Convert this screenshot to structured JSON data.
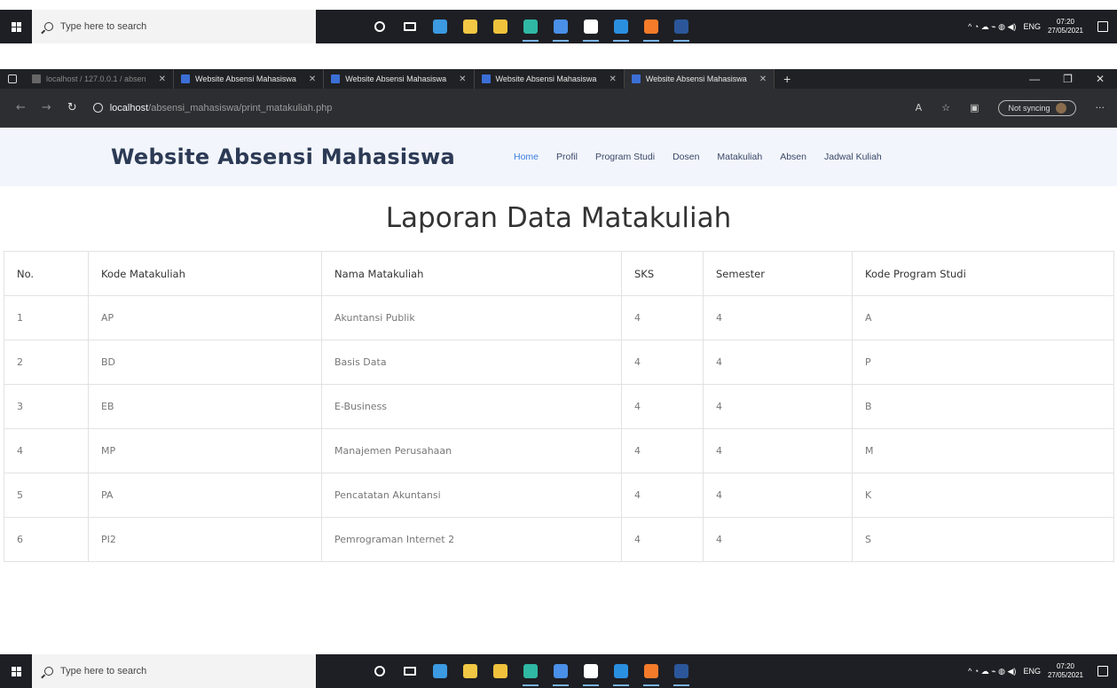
{
  "taskbar": {
    "search_placeholder": "Type here to search",
    "apps": [
      {
        "name": "cortana-icon",
        "color": "#ffffff"
      },
      {
        "name": "task-view-icon",
        "color": "#ffffff"
      },
      {
        "name": "edge-legacy-icon",
        "color": "#3b9ae1"
      },
      {
        "name": "file-explorer-icon",
        "color": "#f2c744"
      },
      {
        "name": "store-icon",
        "color": "#f0c23c"
      },
      {
        "name": "edge-icon",
        "color": "#2fb8a3"
      },
      {
        "name": "chrome-icon",
        "color": "#4a8fe8"
      },
      {
        "name": "settings-icon",
        "color": "#ffffff"
      },
      {
        "name": "vscode-icon",
        "color": "#2b8fe0"
      },
      {
        "name": "xampp-icon",
        "color": "#f47b2a"
      },
      {
        "name": "word-icon",
        "color": "#2b579a"
      }
    ],
    "tray": {
      "lang": "ENG",
      "time": "07:20",
      "date": "27/05/2021"
    }
  },
  "browser": {
    "tabs": [
      {
        "title": "localhost / 127.0.0.1 / absen",
        "active": false,
        "dim": true
      },
      {
        "title": "Website Absensi Mahasiswa",
        "active": false,
        "dim": false
      },
      {
        "title": "Website Absensi Mahasiswa",
        "active": false,
        "dim": false
      },
      {
        "title": "Website Absensi Mahasiswa",
        "active": false,
        "dim": false
      },
      {
        "title": "Website Absensi Mahasiswa",
        "active": true,
        "dim": false
      }
    ],
    "url_host": "localhost",
    "url_path": "/absensi_mahasiswa/print_matakuliah.php",
    "sync_label": "Not syncing"
  },
  "site": {
    "title": "Website Absensi Mahasiswa",
    "nav": [
      "Home",
      "Profil",
      "Program Studi",
      "Dosen",
      "Matakuliah",
      "Absen",
      "Jadwal Kuliah"
    ],
    "active_nav": "Home"
  },
  "report": {
    "title": "Laporan Data Matakuliah",
    "columns": [
      "No.",
      "Kode Matakuliah",
      "Nama Matakuliah",
      "SKS",
      "Semester",
      "Kode Program Studi"
    ],
    "rows": [
      [
        "1",
        "AP",
        "Akuntansi Publik",
        "4",
        "4",
        "A"
      ],
      [
        "2",
        "BD",
        "Basis Data",
        "4",
        "4",
        "P"
      ],
      [
        "3",
        "EB",
        "E-Business",
        "4",
        "4",
        "B"
      ],
      [
        "4",
        "MP",
        "Manajemen Perusahaan",
        "4",
        "4",
        "M"
      ],
      [
        "5",
        "PA",
        "Pencatatan Akuntansi",
        "4",
        "4",
        "K"
      ],
      [
        "6",
        "PI2",
        "Pemrograman Internet 2",
        "4",
        "4",
        "S"
      ]
    ]
  }
}
